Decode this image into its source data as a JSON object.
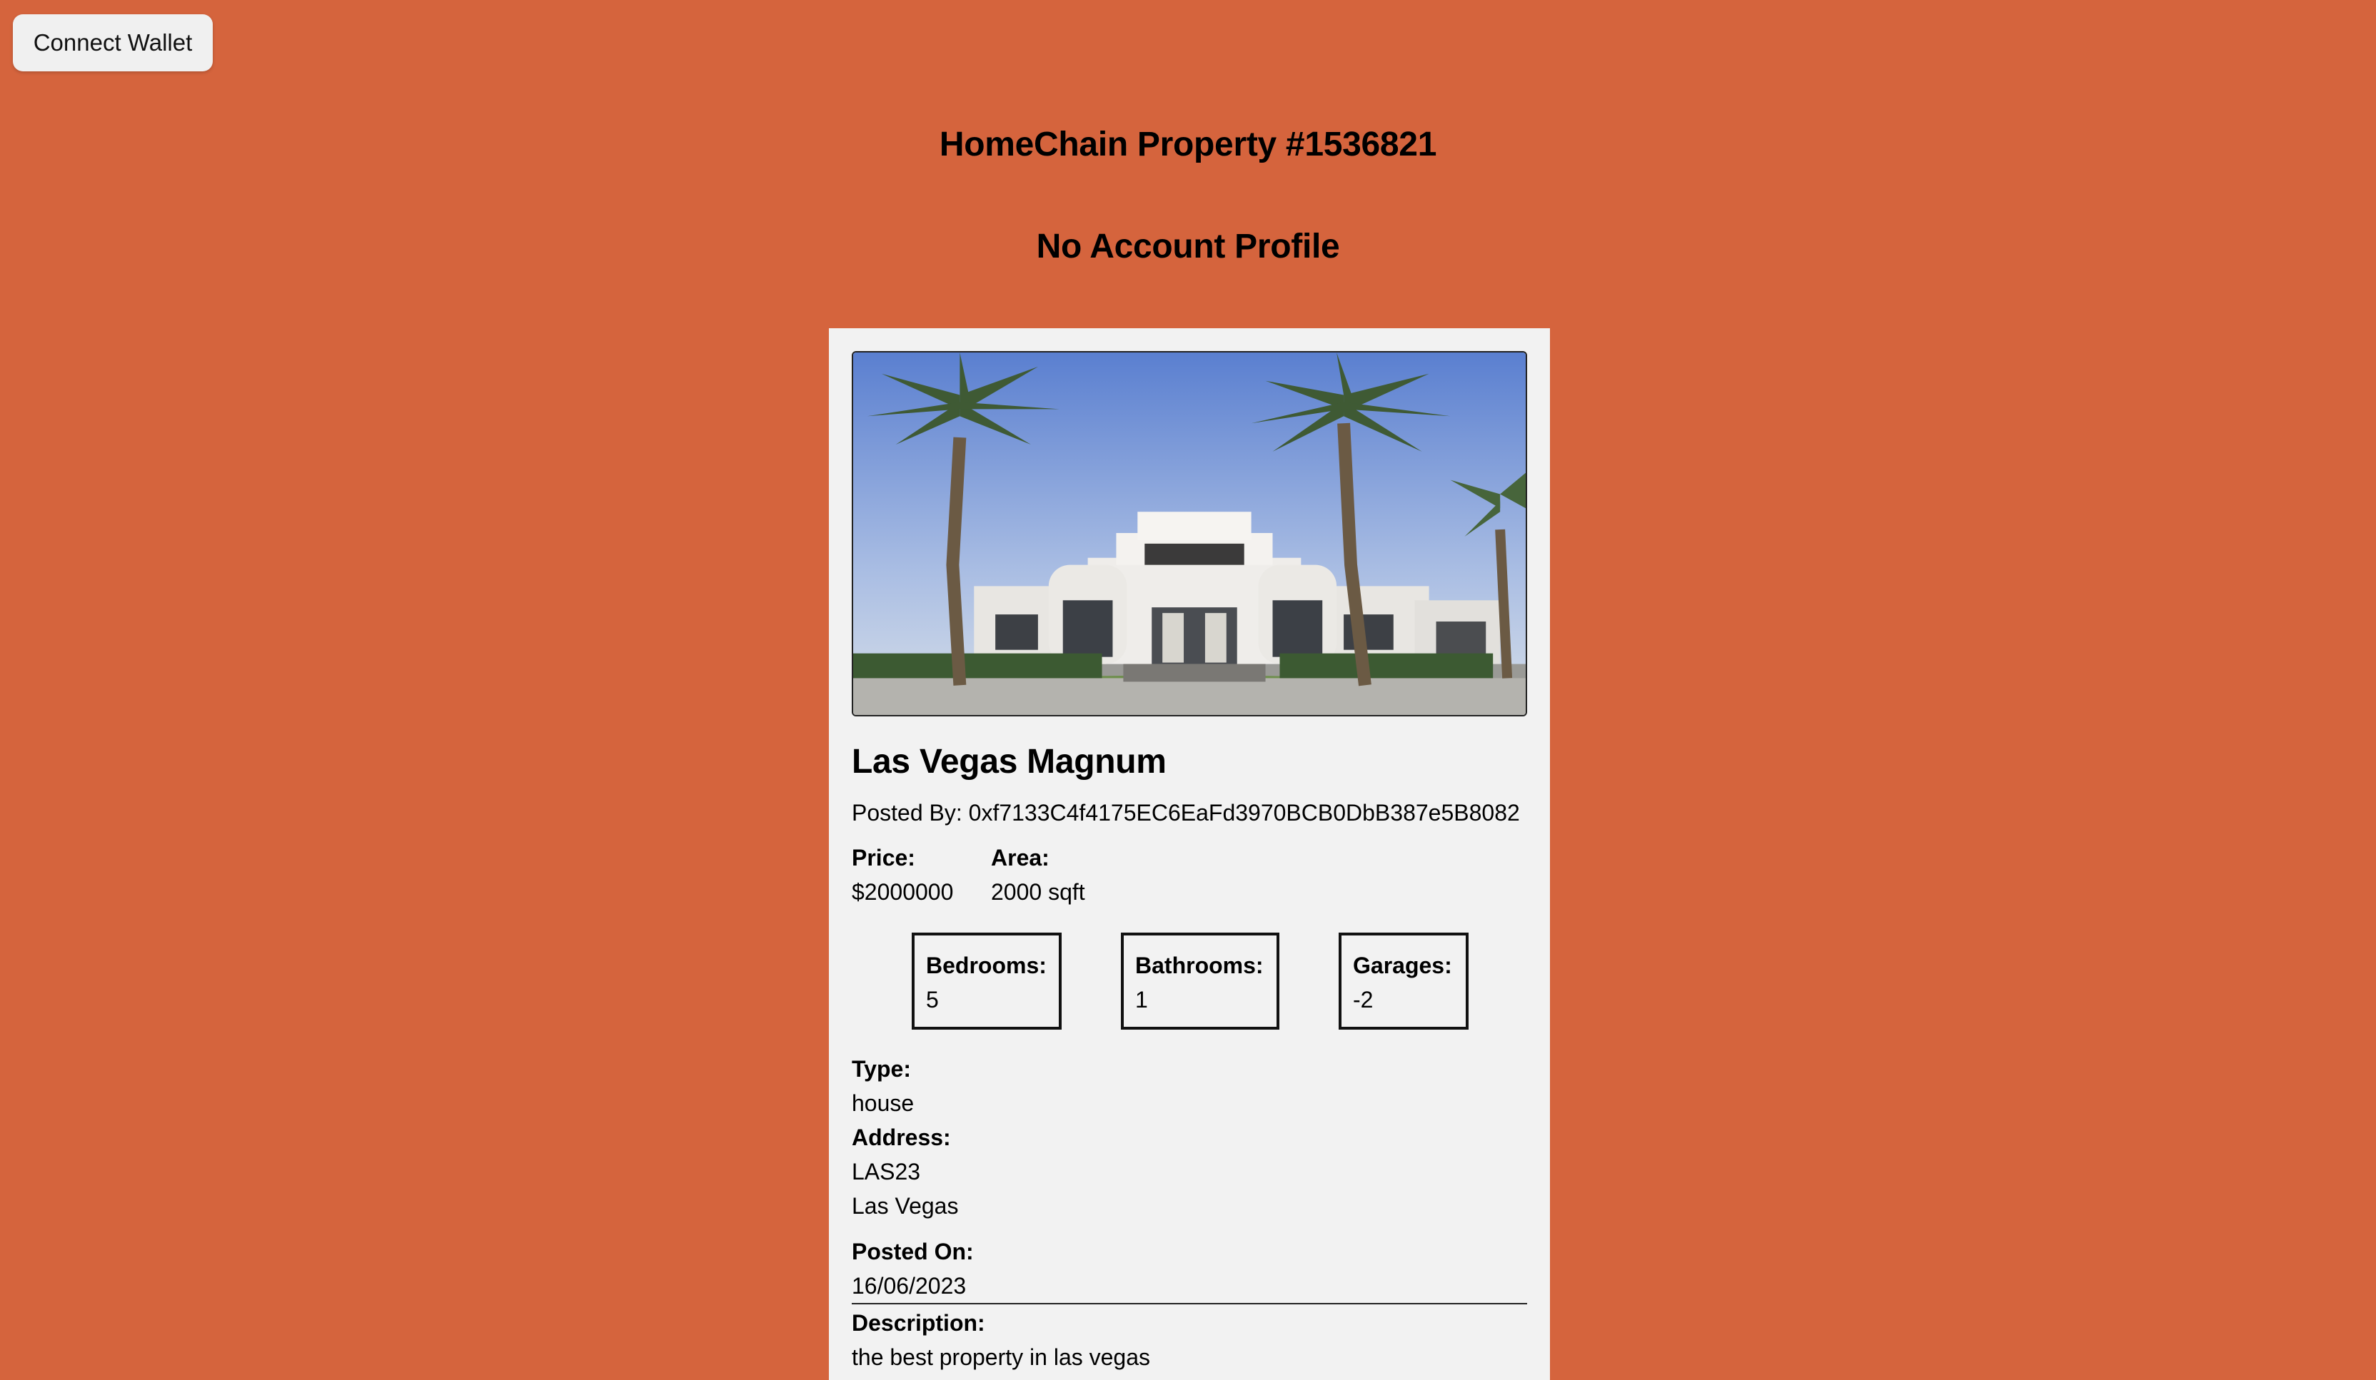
{
  "header": {
    "connect_wallet_label": "Connect Wallet",
    "page_title": "HomeChain Property #1536821",
    "profile_title": "No Account Profile"
  },
  "property": {
    "image_icon": "house-photo",
    "name": "Las Vegas Magnum",
    "posted_by": "Posted By: 0xf7133C4f4175EC6EaFd3970BCB0DbB387e5B8082",
    "price_label": "Price:",
    "price_value": "$2000000",
    "area_label": "Area:",
    "area_value": "2000 sqft",
    "bedrooms_label": "Bedrooms:",
    "bedrooms_value": "5",
    "bathrooms_label": "Bathrooms:",
    "bathrooms_value": "1",
    "garages_label": "Garages:",
    "garages_value": "-2",
    "type_label": "Type:",
    "type_value": "house",
    "address_label": "Address:",
    "address_line1": "LAS23",
    "address_line2": "Las Vegas",
    "posted_on_label": "Posted On:",
    "posted_on_value": "16/06/2023",
    "description_label": "Description:",
    "description_value": "the best property in las vegas"
  },
  "colors": {
    "page_background": "#d5643d",
    "card_background": "#f2f2f2",
    "button_background": "#f0f0f0"
  }
}
